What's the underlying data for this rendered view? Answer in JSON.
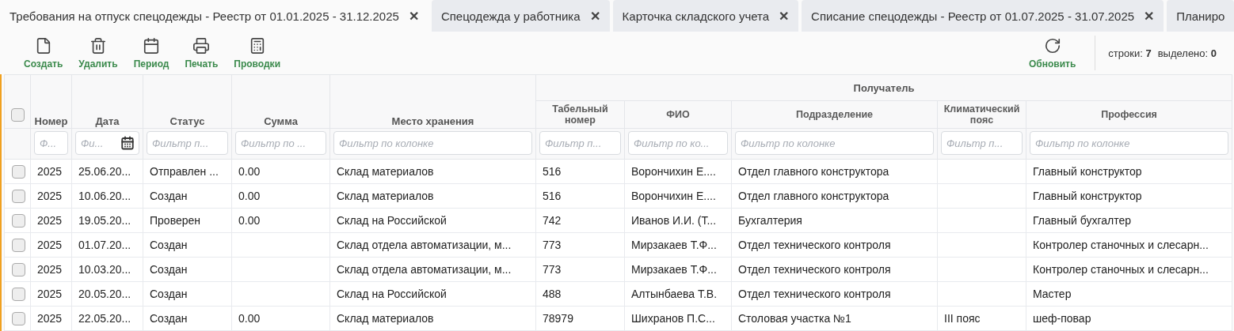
{
  "tabs": [
    {
      "label": "Требования на отпуск спецодежды - Реестр от 01.01.2025 - 31.12.2025",
      "close": "✕",
      "selected": true
    },
    {
      "label": "Спецодежда у работника",
      "close": "✕",
      "selected": false
    },
    {
      "label": "Карточка складского учета",
      "close": "✕",
      "selected": false
    },
    {
      "label": "Списание спецодежды - Реестр от 01.07.2025 - 31.07.2025",
      "close": "✕",
      "selected": false
    },
    {
      "label": "Планиро",
      "selected": false
    }
  ],
  "toolbar": {
    "buttons": [
      {
        "kind": "file",
        "label": "Создать"
      },
      {
        "kind": "trash",
        "label": "Удалить"
      },
      {
        "kind": "calendar",
        "label": "Период"
      },
      {
        "kind": "printer",
        "label": "Печать"
      },
      {
        "kind": "calculator",
        "label": "Проводки"
      }
    ],
    "right_buttons": [
      {
        "kind": "refresh",
        "label": "Обновить"
      }
    ],
    "rows_count": "строки: **7**",
    "selected_count": "выделено: **0**"
  },
  "table": {
    "select_all": {
      "checked": false
    },
    "group_header": "Получатель",
    "columns": [
      {
        "label": "Номер",
        "placeholder": "Ф...",
        "group": false
      },
      {
        "label": "Дата",
        "placeholder": "Фи...",
        "group": false,
        "calendar": true
      },
      {
        "label": "Статус",
        "placeholder": "Фильтр п...",
        "group": false
      },
      {
        "label": "Сумма",
        "placeholder": "Фильтр по ...",
        "group": false
      },
      {
        "label": "Место хранения",
        "placeholder": "Фильтр по колонке",
        "group": false
      },
      {
        "label": "Табельный номер",
        "placeholder": "Фильтр п...",
        "group": true
      },
      {
        "label": "ФИО",
        "placeholder": "Фильтр по ко...",
        "group": true
      },
      {
        "label": "Подразделение",
        "placeholder": "Фильтр по колонке",
        "group": true
      },
      {
        "label": "Климатический пояс",
        "placeholder": "Фильтр п...",
        "group": true
      },
      {
        "label": "Профессия",
        "placeholder": "Фильтр по колонке",
        "group": true
      }
    ],
    "rows": [
      {
        "checked": false,
        "cells": [
          "2025",
          "25.06.20...",
          "Отправлен ...",
          "0.00",
          "Склад материалов",
          "516",
          "Ворончихин Е....",
          "Отдел главного конструктора",
          "",
          "Главный конструктор"
        ]
      },
      {
        "checked": false,
        "cells": [
          "2025",
          "10.06.20...",
          "Создан",
          "0.00",
          "Склад материалов",
          "516",
          "Ворончихин Е....",
          "Отдел главного конструктора",
          "",
          "Главный конструктор"
        ]
      },
      {
        "checked": false,
        "cells": [
          "2025",
          "19.05.20...",
          "Проверен",
          "0.00",
          "Склад на Российской",
          "742",
          "Иванов И.И. (Т...",
          "Бухгалтерия",
          "",
          "Главный бухгалтер"
        ]
      },
      {
        "checked": false,
        "cells": [
          "2025",
          "01.07.20...",
          "Создан",
          "",
          "Склад отдела автоматизации, м...",
          "773",
          "Мирзакаев Т.Ф...",
          "Отдел технического контроля",
          "",
          "Контролер станочных и слесарн..."
        ]
      },
      {
        "checked": false,
        "cells": [
          "2025",
          "10.03.20...",
          "Создан",
          "",
          "Склад отдела автоматизации, м...",
          "773",
          "Мирзакаев Т.Ф...",
          "Отдел технического контроля",
          "",
          "Контролер станочных и слесарн..."
        ]
      },
      {
        "checked": false,
        "cells": [
          "2025",
          "20.05.20...",
          "Создан",
          "",
          "Склад на Российской",
          "488",
          "Алтынбаева Т.В.",
          "Отдел технического контроля",
          "",
          "Мастер"
        ]
      },
      {
        "checked": false,
        "cells": [
          "2025",
          "22.05.20...",
          "Создан",
          "0.00",
          "Склад материалов",
          "78979",
          "Шихранов П.С...",
          "Столовая участка №1",
          "III пояс",
          "шеф-повар"
        ]
      }
    ]
  }
}
